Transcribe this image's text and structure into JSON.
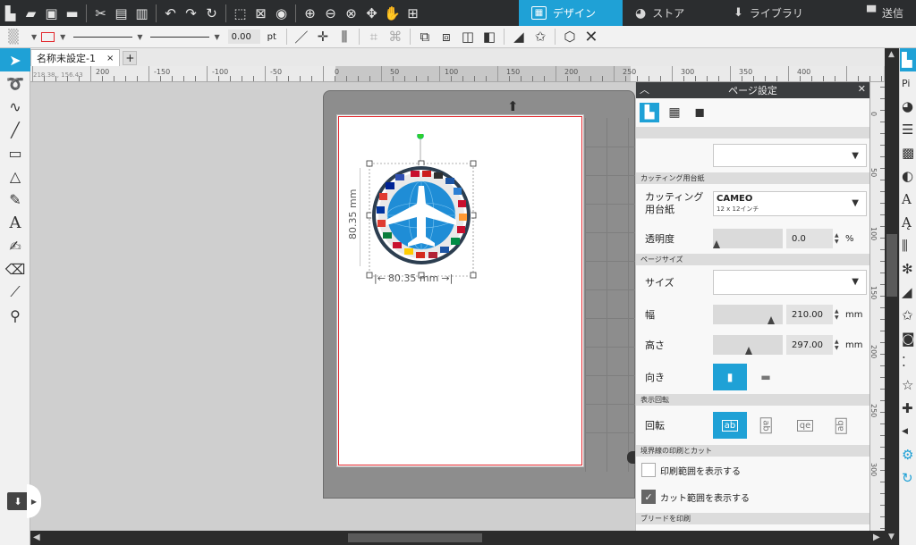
{
  "topbar": {
    "tabs": [
      {
        "label": "デザイン",
        "icon": "design-grid-icon",
        "active": true
      },
      {
        "label": "ストア",
        "icon": "store-icon",
        "active": false
      },
      {
        "label": "ライブラリ",
        "icon": "library-icon",
        "active": false
      },
      {
        "label": "送信",
        "icon": "send-icon",
        "active": false
      }
    ]
  },
  "toolbar2": {
    "line_width": "0.00",
    "unit": "pt"
  },
  "document": {
    "tab_title": "名称未設定-1",
    "close": "×",
    "add": "+"
  },
  "ruler": {
    "coords": "218.38 , 156.43",
    "h_labels": [
      "200",
      "-150",
      "-100",
      "-50",
      "0",
      "50",
      "100",
      "150",
      "200",
      "250",
      "300",
      "350",
      "400"
    ],
    "v_labels": [
      "0",
      "50",
      "100",
      "150",
      "200",
      "250",
      "300"
    ]
  },
  "canvas": {
    "dimension_width": "80.35 mm",
    "dimension_height": "80.35 mm"
  },
  "panel": {
    "title": "ページ設定",
    "sections": {
      "cutting_mat": "カッティング用台紙",
      "page_size": "ページサイズ",
      "display_rotation": "表示回転",
      "border_print_cut": "境界線の印刷とカット",
      "bleed": "ブリードを印刷"
    },
    "mat_label": "カッティング用台紙",
    "mat_name": "CAMEO",
    "mat_size": "12 x 12インチ",
    "transparency_label": "透明度",
    "transparency_value": "0.0",
    "transparency_unit": "%",
    "size_label": "サイズ",
    "width_label": "幅",
    "width_value": "210.00",
    "height_label": "高さ",
    "height_value": "297.00",
    "length_unit": "mm",
    "orientation_label": "向き",
    "rotation_label": "回転",
    "rotation_options": [
      "ab",
      "ab",
      "qe",
      "ab"
    ],
    "show_print_area": "印刷範囲を表示する",
    "show_print_area_checked": false,
    "show_cut_area": "カット範囲を表示する",
    "show_cut_area_checked": true
  }
}
